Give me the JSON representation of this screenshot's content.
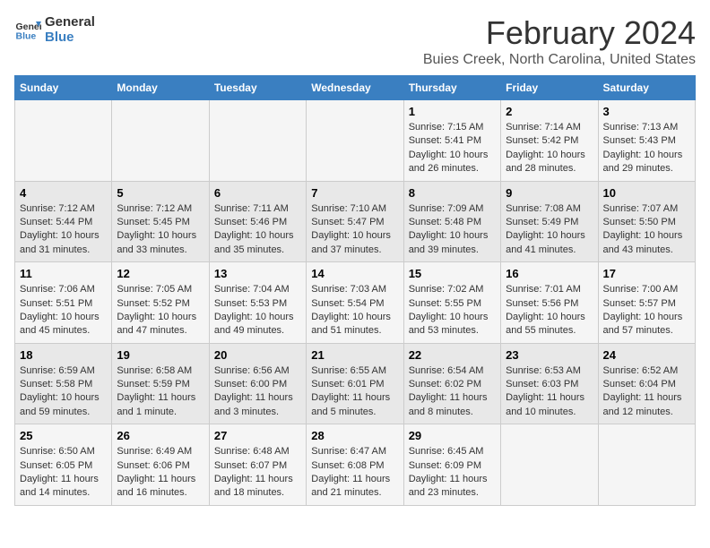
{
  "logo": {
    "line1": "General",
    "line2": "Blue"
  },
  "title": "February 2024",
  "subtitle": "Buies Creek, North Carolina, United States",
  "days_of_week": [
    "Sunday",
    "Monday",
    "Tuesday",
    "Wednesday",
    "Thursday",
    "Friday",
    "Saturday"
  ],
  "rows": [
    [
      {
        "num": "",
        "info": ""
      },
      {
        "num": "",
        "info": ""
      },
      {
        "num": "",
        "info": ""
      },
      {
        "num": "",
        "info": ""
      },
      {
        "num": "1",
        "info": "Sunrise: 7:15 AM\nSunset: 5:41 PM\nDaylight: 10 hours\nand 26 minutes."
      },
      {
        "num": "2",
        "info": "Sunrise: 7:14 AM\nSunset: 5:42 PM\nDaylight: 10 hours\nand 28 minutes."
      },
      {
        "num": "3",
        "info": "Sunrise: 7:13 AM\nSunset: 5:43 PM\nDaylight: 10 hours\nand 29 minutes."
      }
    ],
    [
      {
        "num": "4",
        "info": "Sunrise: 7:12 AM\nSunset: 5:44 PM\nDaylight: 10 hours\nand 31 minutes."
      },
      {
        "num": "5",
        "info": "Sunrise: 7:12 AM\nSunset: 5:45 PM\nDaylight: 10 hours\nand 33 minutes."
      },
      {
        "num": "6",
        "info": "Sunrise: 7:11 AM\nSunset: 5:46 PM\nDaylight: 10 hours\nand 35 minutes."
      },
      {
        "num": "7",
        "info": "Sunrise: 7:10 AM\nSunset: 5:47 PM\nDaylight: 10 hours\nand 37 minutes."
      },
      {
        "num": "8",
        "info": "Sunrise: 7:09 AM\nSunset: 5:48 PM\nDaylight: 10 hours\nand 39 minutes."
      },
      {
        "num": "9",
        "info": "Sunrise: 7:08 AM\nSunset: 5:49 PM\nDaylight: 10 hours\nand 41 minutes."
      },
      {
        "num": "10",
        "info": "Sunrise: 7:07 AM\nSunset: 5:50 PM\nDaylight: 10 hours\nand 43 minutes."
      }
    ],
    [
      {
        "num": "11",
        "info": "Sunrise: 7:06 AM\nSunset: 5:51 PM\nDaylight: 10 hours\nand 45 minutes."
      },
      {
        "num": "12",
        "info": "Sunrise: 7:05 AM\nSunset: 5:52 PM\nDaylight: 10 hours\nand 47 minutes."
      },
      {
        "num": "13",
        "info": "Sunrise: 7:04 AM\nSunset: 5:53 PM\nDaylight: 10 hours\nand 49 minutes."
      },
      {
        "num": "14",
        "info": "Sunrise: 7:03 AM\nSunset: 5:54 PM\nDaylight: 10 hours\nand 51 minutes."
      },
      {
        "num": "15",
        "info": "Sunrise: 7:02 AM\nSunset: 5:55 PM\nDaylight: 10 hours\nand 53 minutes."
      },
      {
        "num": "16",
        "info": "Sunrise: 7:01 AM\nSunset: 5:56 PM\nDaylight: 10 hours\nand 55 minutes."
      },
      {
        "num": "17",
        "info": "Sunrise: 7:00 AM\nSunset: 5:57 PM\nDaylight: 10 hours\nand 57 minutes."
      }
    ],
    [
      {
        "num": "18",
        "info": "Sunrise: 6:59 AM\nSunset: 5:58 PM\nDaylight: 10 hours\nand 59 minutes."
      },
      {
        "num": "19",
        "info": "Sunrise: 6:58 AM\nSunset: 5:59 PM\nDaylight: 11 hours\nand 1 minute."
      },
      {
        "num": "20",
        "info": "Sunrise: 6:56 AM\nSunset: 6:00 PM\nDaylight: 11 hours\nand 3 minutes."
      },
      {
        "num": "21",
        "info": "Sunrise: 6:55 AM\nSunset: 6:01 PM\nDaylight: 11 hours\nand 5 minutes."
      },
      {
        "num": "22",
        "info": "Sunrise: 6:54 AM\nSunset: 6:02 PM\nDaylight: 11 hours\nand 8 minutes."
      },
      {
        "num": "23",
        "info": "Sunrise: 6:53 AM\nSunset: 6:03 PM\nDaylight: 11 hours\nand 10 minutes."
      },
      {
        "num": "24",
        "info": "Sunrise: 6:52 AM\nSunset: 6:04 PM\nDaylight: 11 hours\nand 12 minutes."
      }
    ],
    [
      {
        "num": "25",
        "info": "Sunrise: 6:50 AM\nSunset: 6:05 PM\nDaylight: 11 hours\nand 14 minutes."
      },
      {
        "num": "26",
        "info": "Sunrise: 6:49 AM\nSunset: 6:06 PM\nDaylight: 11 hours\nand 16 minutes."
      },
      {
        "num": "27",
        "info": "Sunrise: 6:48 AM\nSunset: 6:07 PM\nDaylight: 11 hours\nand 18 minutes."
      },
      {
        "num": "28",
        "info": "Sunrise: 6:47 AM\nSunset: 6:08 PM\nDaylight: 11 hours\nand 21 minutes."
      },
      {
        "num": "29",
        "info": "Sunrise: 6:45 AM\nSunset: 6:09 PM\nDaylight: 11 hours\nand 23 minutes."
      },
      {
        "num": "",
        "info": ""
      },
      {
        "num": "",
        "info": ""
      }
    ]
  ]
}
